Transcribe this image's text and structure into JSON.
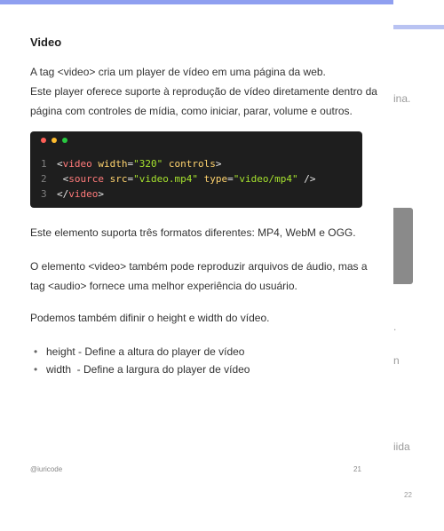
{
  "colors": {
    "accent": "#8f9ff0",
    "code_bg": "#1e1e1e"
  },
  "page": {
    "title": "Video",
    "intro_lines": [
      "A tag <video> cria um player de vídeo em uma página da web.",
      "Este player oferece suporte à reprodução de vídeo diretamente dentro da",
      "página com controles de mídia, como iniciar, parar, volume e outros."
    ],
    "code": {
      "dot_colors": [
        "#ff5f57",
        "#febc2e",
        "#28c840"
      ],
      "lines": [
        {
          "num": "1",
          "indent": "",
          "open": "<",
          "tag": "video",
          "attrs": [
            {
              "name": "width",
              "value": "\"320\""
            },
            {
              "name": "controls",
              "value": ""
            }
          ],
          "close": ">"
        },
        {
          "num": "2",
          "indent": " ",
          "open": "<",
          "tag": "source",
          "attrs": [
            {
              "name": "src",
              "value": "\"video.mp4\""
            },
            {
              "name": "type",
              "value": "\"video/mp4\""
            }
          ],
          "close": " />"
        },
        {
          "num": "3",
          "indent": "",
          "open": "</",
          "tag": "video",
          "attrs": [],
          "close": ">"
        }
      ]
    },
    "formats_text": "Este elemento suporta três formatos diferentes: MP4, WebM e OGG.",
    "audio_lines": [
      "O elemento <video> também pode reproduzir arquivos de áudio, mas a",
      "tag <audio> fornece uma melhor experiência do usuário."
    ],
    "size_text": "Podemos também difinir o height e width do vídeo.",
    "bullets": [
      "height - Define a altura do player de vídeo",
      "width  - Define a largura do player de vídeo"
    ],
    "footer_author": "@iuricode",
    "footer_page": "21"
  },
  "next_page": {
    "fragments": [
      "ina.",
      ".",
      "n",
      "iida"
    ],
    "page_number": "22"
  }
}
